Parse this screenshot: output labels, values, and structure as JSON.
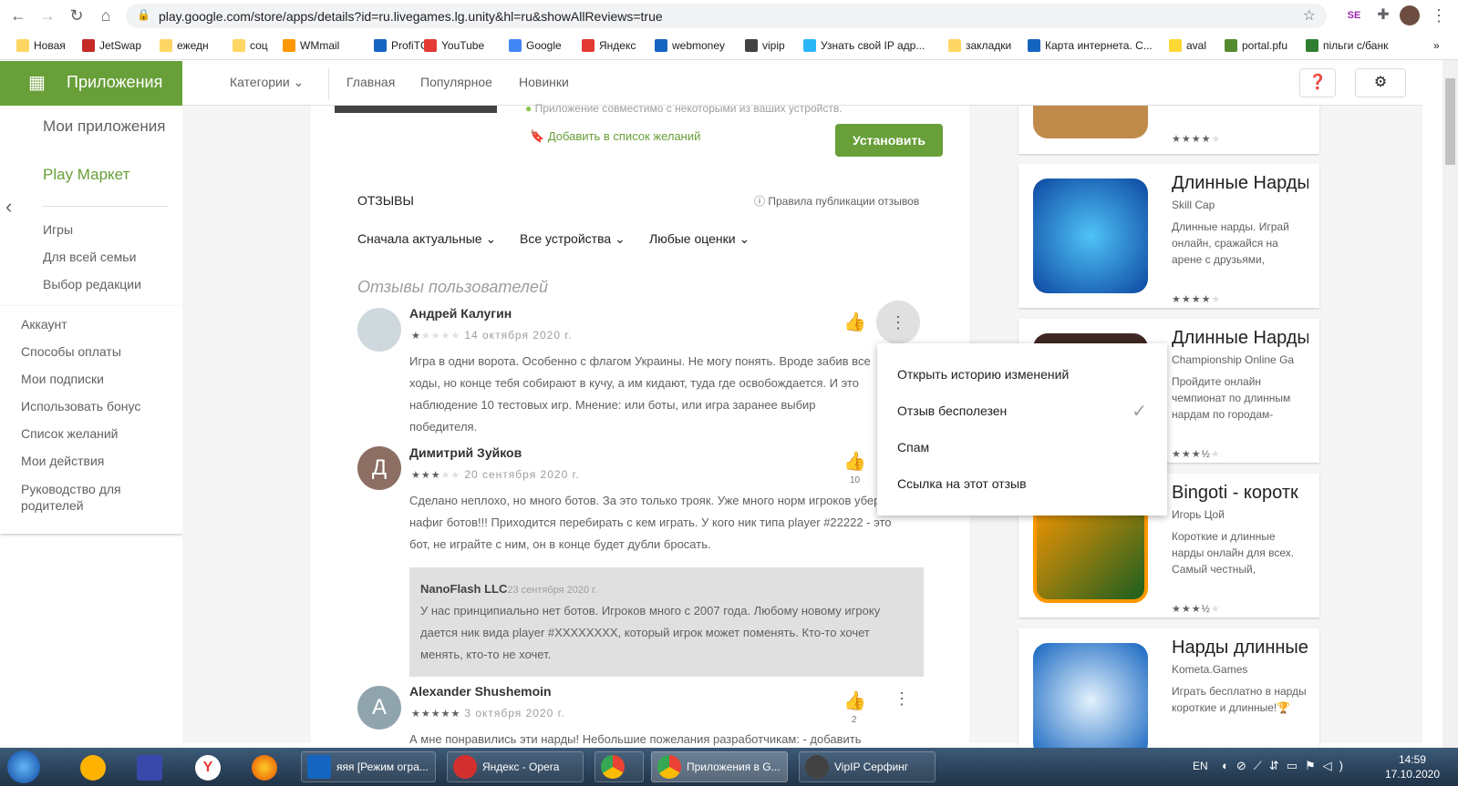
{
  "browser": {
    "url": "play.google.com/store/apps/details?id=ru.livegames.lg.unity&hl=ru&showAllReviews=true",
    "bookmarks": [
      "Новая",
      "JetSwap",
      "ежедн",
      "соц",
      "WMmail",
      "ProfiTC",
      "YouTube",
      "Google",
      "Яндекс",
      "webmoney",
      "vipip",
      "Узнать свой IP адр...",
      "закладки",
      "Карта интернета. С...",
      "aval",
      "portal.pfu",
      "пільги с/банк"
    ]
  },
  "header": {
    "apps_title": "Приложения",
    "categories": "Категории",
    "nav": [
      "Главная",
      "Популярное",
      "Новинки"
    ]
  },
  "sidebar": {
    "my_apps": "Мои приложения",
    "play_market": "Play Маркет",
    "items": [
      "Игры",
      "Для всей семьи",
      "Выбор редакции"
    ],
    "account_items": [
      "Аккаунт",
      "Способы оплаты",
      "Мои подписки",
      "Использовать бонус",
      "Список желаний",
      "Мои действия",
      "Руководство для родителей"
    ]
  },
  "app": {
    "compat": "Приложение совместимо с некоторыми из ваших устройств.",
    "wishlist": "Добавить в список желаний",
    "install": "Установить"
  },
  "reviews": {
    "heading": "ОТЗЫВЫ",
    "policy": "Правила публикации отзывов",
    "filters": [
      "Сначала актуальные",
      "Все устройства",
      "Любые оценки"
    ],
    "user_reviews_title": "Отзывы пользователей",
    "items": [
      {
        "name": "Андрей Калугин",
        "rating": 1,
        "date": "14 октября 2020 г.",
        "text": "Игра в одни ворота. Особенно с флагом Украины. Не могу понять. Вроде забив все ходы, но конце тебя собирают в кучу, а им кидают, туда где освобождается. И это наблюдение 10 тестовых игр. Мнение: или боты, или игра заранее выбир победителя.",
        "likes": ""
      },
      {
        "name": "Димитрий Зуйков",
        "initial": "Д",
        "rating": 3,
        "date": "20 сентября 2020 г.",
        "text": "Сделано неплохо, но много ботов. За это только трояк. Уже много норм игроков уберите нафиг ботов!!! Приходится перебирать с кем играть. У кого ник типа player #22222 - это бот, не играйте с ним, он в конце будет дубли бросать.",
        "likes": "10",
        "reply": {
          "name": "NanoFlash LLC",
          "date": "23 сентября 2020 г.",
          "text": "У нас принципиально нет ботов. Игроков много с 2007 года. Любому новому игроку дается ник вида player #XXXXXXXX, который игрок может поменять. Кто-то хочет менять, кто-то не хочет."
        }
      },
      {
        "name": "Alexander Shushemoin",
        "initial": "A",
        "rating": 5,
        "date": "3 октября 2020 г.",
        "text": "А мне понравились эти нарды! Небольшие пожелания разработчикам: - добавить",
        "likes": "2"
      }
    ]
  },
  "menu": {
    "items": [
      "Открыть историю изменений",
      "Отзыв бесполезен",
      "Спам",
      "Ссылка на этот отзыв"
    ],
    "checked_index": 1
  },
  "recommendations": [
    {
      "title": "",
      "dev": "",
      "desc": "",
      "rating": 4
    },
    {
      "title": "Длинные Нарды",
      "dev": "Skill Cap",
      "desc": "Длинные нарды. Играй онлайн, сражайся на арене с друзьями,",
      "rating": 4
    },
    {
      "title": "Длинные Нарды",
      "dev": "Championship Online Ga",
      "desc": "Пройдите онлайн чемпионат по длинным нардам по городам-",
      "rating": 3.5
    },
    {
      "title": "Bingoti - коротк",
      "dev": "Игорь Цой",
      "desc": "Короткие и длинные нарды онлайн для всех. Самый честный,",
      "rating": 3.5
    },
    {
      "title": "Нарды длинные",
      "dev": "Kometa.Games",
      "desc": "Играть бесплатно в нарды короткие и длинные!🏆",
      "rating": 0
    }
  ],
  "taskbar": {
    "tasks": [
      "яяя [Режим огра...",
      "Яндекс - Opera",
      "Приложения в G...",
      "VipIP Серфинг"
    ],
    "lang": "EN",
    "time": "14:59",
    "date": "17.10.2020"
  },
  "colors": {
    "accent": "#689f38",
    "install": "#689f38",
    "scroll": "#c1c1c1"
  }
}
